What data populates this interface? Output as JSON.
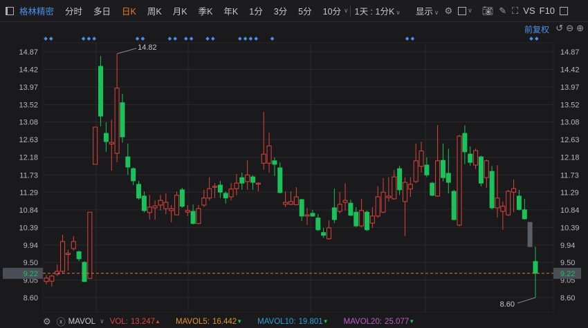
{
  "toolbar": {
    "stock_name": "格林精密",
    "tabs": [
      "分时",
      "多日",
      "日K",
      "周K",
      "月K",
      "季K",
      "年K",
      "1分",
      "3分",
      "5分",
      "10分"
    ],
    "active_tab": "日K",
    "period_select": "1天 : 1分K",
    "display_label": "显示",
    "vs_label": "VS",
    "f10_label": "F10",
    "icons": [
      "sidebar-icon",
      "settings-icon",
      "rectangle-icon",
      "camera-icon",
      "pencil-icon",
      "fullscreen-icon"
    ]
  },
  "subbar": {
    "adjust_label": "前复权",
    "icons": [
      "undo-icon",
      "zoom-out-icon",
      "zoom-in-icon"
    ]
  },
  "colors": {
    "up": "#e0443c",
    "down": "#1bc25b",
    "grid": "#2a2a2c",
    "marker": "#4d8fe8",
    "current_line": "#e07a3a"
  },
  "chart_data": {
    "type": "candlestick",
    "price_ticks": [
      "14.87",
      "14.42",
      "13.97",
      "13.52",
      "13.08",
      "12.63",
      "12.18",
      "11.73",
      "11.29",
      "10.84",
      "10.39",
      "9.94",
      "9.50",
      "9.05",
      "8.60"
    ],
    "ylim": [
      8.6,
      14.87
    ],
    "current_price": "9.22",
    "high_label": "14.82",
    "low_label": "8.60",
    "event_marker_indices": [
      0,
      1,
      7,
      8,
      9,
      17,
      18,
      23,
      24,
      26,
      27,
      30,
      31,
      36,
      37,
      38,
      39,
      42,
      67,
      68,
      90,
      91
    ],
    "candles": [
      [
        9.01,
        9.18,
        8.94,
        9.1
      ],
      [
        9.02,
        9.18,
        8.88,
        9.15
      ],
      [
        9.2,
        9.45,
        9.15,
        9.27
      ],
      [
        9.27,
        10.2,
        9.2,
        10.03
      ],
      [
        9.7,
        9.82,
        9.29,
        9.73
      ],
      [
        9.85,
        10.17,
        9.8,
        10.03
      ],
      [
        9.77,
        9.8,
        9.53,
        9.59
      ],
      [
        9.5,
        9.53,
        9.01,
        9.01
      ],
      [
        9.09,
        10.78,
        9.09,
        10.78
      ],
      [
        12.0,
        12.95,
        12.0,
        12.95
      ],
      [
        14.5,
        14.76,
        12.97,
        13.23
      ],
      [
        12.79,
        13.07,
        12.32,
        12.58
      ],
      [
        12.52,
        13.14,
        11.84,
        12.56
      ],
      [
        12.28,
        14.82,
        12.05,
        13.94
      ],
      [
        13.57,
        13.8,
        12.55,
        12.7
      ],
      [
        12.19,
        12.53,
        11.73,
        11.93
      ],
      [
        11.89,
        11.92,
        11.47,
        11.58
      ],
      [
        11.49,
        11.58,
        11.1,
        11.14
      ],
      [
        11.19,
        11.31,
        10.77,
        10.82
      ],
      [
        10.77,
        11.22,
        10.59,
        10.91
      ],
      [
        10.89,
        11.08,
        10.59,
        10.94
      ],
      [
        10.96,
        11.22,
        10.82,
        11.08
      ],
      [
        10.87,
        11.26,
        10.73,
        11.03
      ],
      [
        10.82,
        10.96,
        10.52,
        10.87
      ],
      [
        10.71,
        11.31,
        10.71,
        11.21
      ],
      [
        11.35,
        11.4,
        10.89,
        10.93
      ],
      [
        10.78,
        10.96,
        10.68,
        10.82
      ],
      [
        10.8,
        10.98,
        10.47,
        10.49
      ],
      [
        10.49,
        10.96,
        10.47,
        10.87
      ],
      [
        10.96,
        11.35,
        10.91,
        11.14
      ],
      [
        11.14,
        11.67,
        11.08,
        11.38
      ],
      [
        11.42,
        11.52,
        11.14,
        11.44
      ],
      [
        11.47,
        11.58,
        11.14,
        11.29
      ],
      [
        11.26,
        11.31,
        11.0,
        11.14
      ],
      [
        11.17,
        11.52,
        11.08,
        11.37
      ],
      [
        11.38,
        11.75,
        11.21,
        11.52
      ],
      [
        11.66,
        11.79,
        11.35,
        11.52
      ],
      [
        11.56,
        12.1,
        11.35,
        11.73
      ],
      [
        11.68,
        11.72,
        11.35,
        11.54
      ],
      [
        11.5,
        11.54,
        11.31,
        11.52
      ],
      [
        12.03,
        13.34,
        11.86,
        12.26
      ],
      [
        12.03,
        12.81,
        11.79,
        12.47
      ],
      [
        12.09,
        12.18,
        11.7,
        12.0
      ],
      [
        11.91,
        12.05,
        11.26,
        11.28
      ],
      [
        10.98,
        11.31,
        10.91,
        11.03
      ],
      [
        10.98,
        11.31,
        10.96,
        11.05
      ],
      [
        10.97,
        11.42,
        10.96,
        11.17
      ],
      [
        11.1,
        11.12,
        10.56,
        10.68
      ],
      [
        10.68,
        10.89,
        10.45,
        10.71
      ],
      [
        10.75,
        10.84,
        10.66,
        10.68
      ],
      [
        10.63,
        10.73,
        10.3,
        10.33
      ],
      [
        10.26,
        10.38,
        10.12,
        10.19
      ],
      [
        10.1,
        10.57,
        10.08,
        10.38
      ],
      [
        10.89,
        11.38,
        10.5,
        10.59
      ],
      [
        10.8,
        11.29,
        10.75,
        10.98
      ],
      [
        11.03,
        11.52,
        10.82,
        11.08
      ],
      [
        11.01,
        11.1,
        10.68,
        10.7
      ],
      [
        10.78,
        10.91,
        10.4,
        10.43
      ],
      [
        10.43,
        11.12,
        10.4,
        10.82
      ],
      [
        10.78,
        10.82,
        10.3,
        10.33
      ],
      [
        10.5,
        10.91,
        10.38,
        10.68
      ],
      [
        10.68,
        11.44,
        10.64,
        11.17
      ],
      [
        10.78,
        11.65,
        10.75,
        11.29
      ],
      [
        11.15,
        11.67,
        11.05,
        11.19
      ],
      [
        11.12,
        11.86,
        11.1,
        11.68
      ],
      [
        11.89,
        11.96,
        11.22,
        11.35
      ],
      [
        11.05,
        11.67,
        10.17,
        11.54
      ],
      [
        11.37,
        11.67,
        11.17,
        11.49
      ],
      [
        11.56,
        12.53,
        11.52,
        12.09
      ],
      [
        11.95,
        12.58,
        11.79,
        12.34
      ],
      [
        11.98,
        12.18,
        11.67,
        11.73
      ],
      [
        11.52,
        11.55,
        11.19,
        11.21
      ],
      [
        11.19,
        13.0,
        11.17,
        12.09
      ],
      [
        12.1,
        12.53,
        11.56,
        11.66
      ],
      [
        11.77,
        12.4,
        11.26,
        11.54
      ],
      [
        11.31,
        11.35,
        10.57,
        10.59
      ],
      [
        10.45,
        12.75,
        10.42,
        12.72
      ],
      [
        12.79,
        12.99,
        12.0,
        12.32
      ],
      [
        12.26,
        12.46,
        11.96,
        12.05
      ],
      [
        11.98,
        12.4,
        11.88,
        12.35
      ],
      [
        12.19,
        12.22,
        11.44,
        11.52
      ],
      [
        11.66,
        12.12,
        11.4,
        12.09
      ],
      [
        11.82,
        11.96,
        10.85,
        10.89
      ],
      [
        10.89,
        11.98,
        10.64,
        11.14
      ],
      [
        10.8,
        11.05,
        10.33,
        10.93
      ],
      [
        10.71,
        11.35,
        10.68,
        11.31
      ],
      [
        11.29,
        11.61,
        10.78,
        11.38
      ],
      [
        11.19,
        11.35,
        10.82,
        10.85
      ],
      [
        10.84,
        11.12,
        10.59,
        10.61
      ],
      [
        10.52,
        10.52,
        9.9,
        9.9
      ],
      [
        9.52,
        9.9,
        8.6,
        9.22
      ]
    ],
    "gray_candle_indices": [
      89
    ]
  },
  "indicator": {
    "name": "MAVOL",
    "vol_label": "VOL:",
    "vol_value": "13.247",
    "vol_arrow": "▲",
    "ma5_label": "MAVOL5:",
    "ma5_value": "16.442",
    "ma5_arrow": "▼",
    "ma10_label": "MAVOL10:",
    "ma10_value": "19.801",
    "ma10_arrow": "▼",
    "ma20_label": "MAVOL20:",
    "ma20_value": "25.077",
    "ma20_arrow": "▼"
  }
}
